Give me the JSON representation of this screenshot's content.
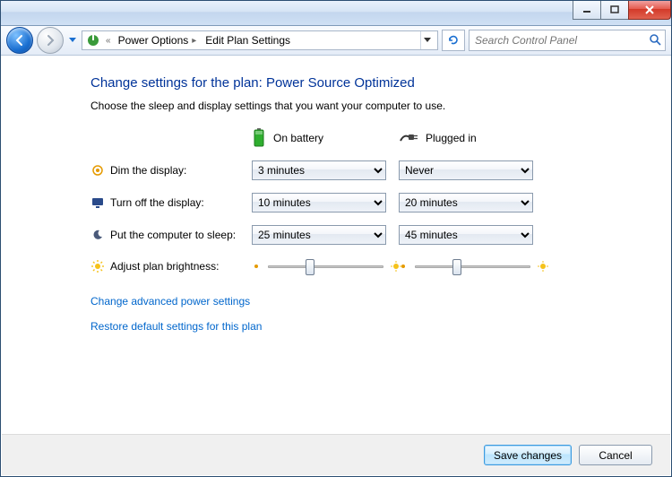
{
  "breadcrumb": {
    "seg1": "Power Options",
    "seg2": "Edit Plan Settings"
  },
  "search": {
    "placeholder": "Search Control Panel"
  },
  "heading": "Change settings for the plan: Power Source Optimized",
  "subheading": "Choose the sleep and display settings that you want your computer to use.",
  "column_headers": {
    "battery": "On battery",
    "plugged": "Plugged in"
  },
  "rows": {
    "dim": {
      "label": "Dim the display:",
      "battery": "3 minutes",
      "plugged": "Never"
    },
    "off": {
      "label": "Turn off the display:",
      "battery": "10 minutes",
      "plugged": "20 minutes"
    },
    "sleep": {
      "label": "Put the computer to sleep:",
      "battery": "25 minutes",
      "plugged": "45 minutes"
    },
    "bright": {
      "label": "Adjust plan brightness:"
    }
  },
  "links": {
    "advanced": "Change advanced power settings",
    "restore": "Restore default settings for this plan"
  },
  "buttons": {
    "save": "Save changes",
    "cancel": "Cancel"
  }
}
